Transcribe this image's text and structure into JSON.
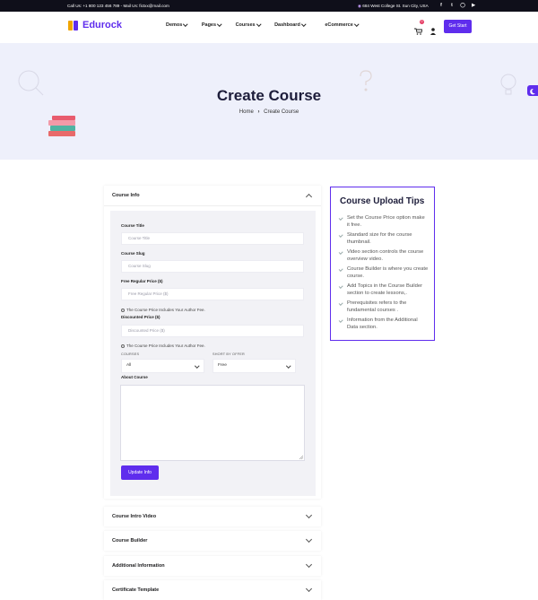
{
  "topbar": {
    "call": "Call Us: +1 800 123 456 789 - Mail Us: fictxx@mail.com",
    "address": "684 West College St. Sun City, USA",
    "social_icons": [
      "facebook-icon",
      "twitter-icon",
      "instagram-icon",
      "youtube-icon"
    ]
  },
  "header": {
    "logo_text": "Edurock",
    "nav": [
      "Demos",
      "Pages",
      "Courses",
      "Dashboard",
      "eCommerce"
    ],
    "cart_count": "0",
    "cta": "Get Start"
  },
  "hero": {
    "title": "Create Course",
    "breadcrumb_home": "Home",
    "breadcrumb_sep": "›",
    "breadcrumb_current": "Create Course"
  },
  "form_panel": {
    "title": "Course Info",
    "course_title_label": "Course Title",
    "course_title_placeholder": "Course Title",
    "course_slug_label": "Course Slug",
    "course_slug_placeholder": "Course Slug",
    "free_price_label": "Free Regular Price ($)",
    "free_price_placeholder": "Free Regular Price ($)",
    "note1": "The Course Price Includes Your Author Fee.",
    "discount_label": "Discounted Price ($)",
    "discount_placeholder": "Discounted Price ($)",
    "note2": "The Course Price Includes Your Author Fee.",
    "courses_caption": "COURSES",
    "courses_value": "All",
    "sort_caption": "SHORT BY OFFER",
    "sort_value": "Free",
    "about_label": "About Course",
    "update_button": "Update Info"
  },
  "accordions": [
    "Course Intro Video",
    "Course Builder",
    "Additional Information",
    "Certificate Template"
  ],
  "tips": {
    "title": "Course Upload Tips",
    "items": [
      "Set the Course Price option make it free.",
      "Standard size for the course thumbnail.",
      "Video section controls the course overview video.",
      "Course Builder is where you create course.",
      "Add Topics in the Course Builder section to create lessons,.",
      "Prerequisites refers to the fundamental courses .",
      "Information from the Additional Data section."
    ]
  },
  "colors": {
    "accent": "#5f2ded",
    "hero_bg": "#eef0fb",
    "topbar_bg": "#0f0f1a"
  }
}
